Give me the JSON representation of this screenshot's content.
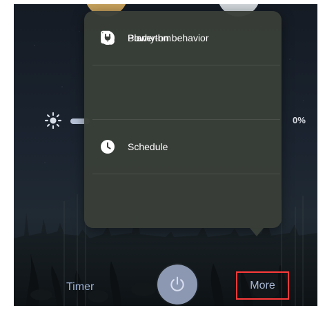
{
  "status": {
    "brightness_percent_label": "0%"
  },
  "menu": {
    "items": [
      {
        "label": "Plan",
        "icon": "plan-icon"
      },
      {
        "label": "Schedule",
        "icon": "schedule-icon"
      },
      {
        "label": "Biorhythm",
        "icon": "biorhythm-icon"
      },
      {
        "label": "Power-on behavior",
        "icon": "power-plug-icon"
      }
    ]
  },
  "bottom_bar": {
    "timer_label": "Timer",
    "more_label": "More"
  },
  "colors": {
    "accent_highlight": "#ff3a3a",
    "popup_bg": "#393e38"
  }
}
